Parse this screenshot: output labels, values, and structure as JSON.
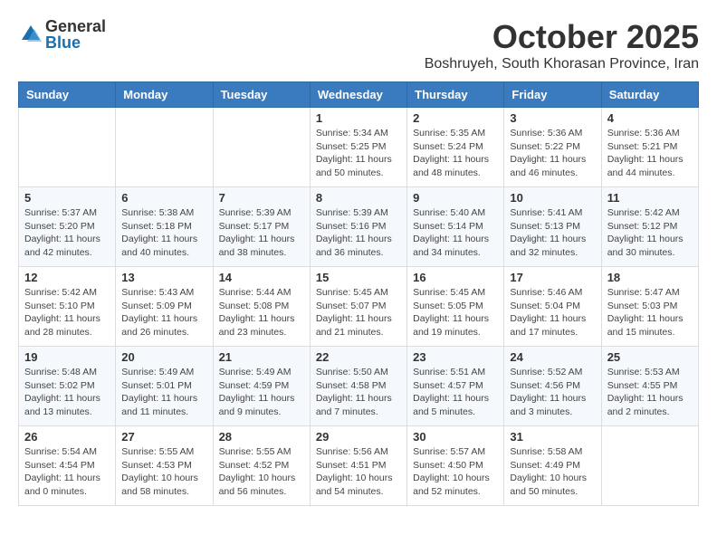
{
  "header": {
    "logo_general": "General",
    "logo_blue": "Blue",
    "month": "October 2025",
    "location": "Boshruyeh, South Khorasan Province, Iran"
  },
  "weekdays": [
    "Sunday",
    "Monday",
    "Tuesday",
    "Wednesday",
    "Thursday",
    "Friday",
    "Saturday"
  ],
  "weeks": [
    [
      {
        "day": "",
        "info": ""
      },
      {
        "day": "",
        "info": ""
      },
      {
        "day": "",
        "info": ""
      },
      {
        "day": "1",
        "info": "Sunrise: 5:34 AM\nSunset: 5:25 PM\nDaylight: 11 hours\nand 50 minutes."
      },
      {
        "day": "2",
        "info": "Sunrise: 5:35 AM\nSunset: 5:24 PM\nDaylight: 11 hours\nand 48 minutes."
      },
      {
        "day": "3",
        "info": "Sunrise: 5:36 AM\nSunset: 5:22 PM\nDaylight: 11 hours\nand 46 minutes."
      },
      {
        "day": "4",
        "info": "Sunrise: 5:36 AM\nSunset: 5:21 PM\nDaylight: 11 hours\nand 44 minutes."
      }
    ],
    [
      {
        "day": "5",
        "info": "Sunrise: 5:37 AM\nSunset: 5:20 PM\nDaylight: 11 hours\nand 42 minutes."
      },
      {
        "day": "6",
        "info": "Sunrise: 5:38 AM\nSunset: 5:18 PM\nDaylight: 11 hours\nand 40 minutes."
      },
      {
        "day": "7",
        "info": "Sunrise: 5:39 AM\nSunset: 5:17 PM\nDaylight: 11 hours\nand 38 minutes."
      },
      {
        "day": "8",
        "info": "Sunrise: 5:39 AM\nSunset: 5:16 PM\nDaylight: 11 hours\nand 36 minutes."
      },
      {
        "day": "9",
        "info": "Sunrise: 5:40 AM\nSunset: 5:14 PM\nDaylight: 11 hours\nand 34 minutes."
      },
      {
        "day": "10",
        "info": "Sunrise: 5:41 AM\nSunset: 5:13 PM\nDaylight: 11 hours\nand 32 minutes."
      },
      {
        "day": "11",
        "info": "Sunrise: 5:42 AM\nSunset: 5:12 PM\nDaylight: 11 hours\nand 30 minutes."
      }
    ],
    [
      {
        "day": "12",
        "info": "Sunrise: 5:42 AM\nSunset: 5:10 PM\nDaylight: 11 hours\nand 28 minutes."
      },
      {
        "day": "13",
        "info": "Sunrise: 5:43 AM\nSunset: 5:09 PM\nDaylight: 11 hours\nand 26 minutes."
      },
      {
        "day": "14",
        "info": "Sunrise: 5:44 AM\nSunset: 5:08 PM\nDaylight: 11 hours\nand 23 minutes."
      },
      {
        "day": "15",
        "info": "Sunrise: 5:45 AM\nSunset: 5:07 PM\nDaylight: 11 hours\nand 21 minutes."
      },
      {
        "day": "16",
        "info": "Sunrise: 5:45 AM\nSunset: 5:05 PM\nDaylight: 11 hours\nand 19 minutes."
      },
      {
        "day": "17",
        "info": "Sunrise: 5:46 AM\nSunset: 5:04 PM\nDaylight: 11 hours\nand 17 minutes."
      },
      {
        "day": "18",
        "info": "Sunrise: 5:47 AM\nSunset: 5:03 PM\nDaylight: 11 hours\nand 15 minutes."
      }
    ],
    [
      {
        "day": "19",
        "info": "Sunrise: 5:48 AM\nSunset: 5:02 PM\nDaylight: 11 hours\nand 13 minutes."
      },
      {
        "day": "20",
        "info": "Sunrise: 5:49 AM\nSunset: 5:01 PM\nDaylight: 11 hours\nand 11 minutes."
      },
      {
        "day": "21",
        "info": "Sunrise: 5:49 AM\nSunset: 4:59 PM\nDaylight: 11 hours\nand 9 minutes."
      },
      {
        "day": "22",
        "info": "Sunrise: 5:50 AM\nSunset: 4:58 PM\nDaylight: 11 hours\nand 7 minutes."
      },
      {
        "day": "23",
        "info": "Sunrise: 5:51 AM\nSunset: 4:57 PM\nDaylight: 11 hours\nand 5 minutes."
      },
      {
        "day": "24",
        "info": "Sunrise: 5:52 AM\nSunset: 4:56 PM\nDaylight: 11 hours\nand 3 minutes."
      },
      {
        "day": "25",
        "info": "Sunrise: 5:53 AM\nSunset: 4:55 PM\nDaylight: 11 hours\nand 2 minutes."
      }
    ],
    [
      {
        "day": "26",
        "info": "Sunrise: 5:54 AM\nSunset: 4:54 PM\nDaylight: 11 hours\nand 0 minutes."
      },
      {
        "day": "27",
        "info": "Sunrise: 5:55 AM\nSunset: 4:53 PM\nDaylight: 10 hours\nand 58 minutes."
      },
      {
        "day": "28",
        "info": "Sunrise: 5:55 AM\nSunset: 4:52 PM\nDaylight: 10 hours\nand 56 minutes."
      },
      {
        "day": "29",
        "info": "Sunrise: 5:56 AM\nSunset: 4:51 PM\nDaylight: 10 hours\nand 54 minutes."
      },
      {
        "day": "30",
        "info": "Sunrise: 5:57 AM\nSunset: 4:50 PM\nDaylight: 10 hours\nand 52 minutes."
      },
      {
        "day": "31",
        "info": "Sunrise: 5:58 AM\nSunset: 4:49 PM\nDaylight: 10 hours\nand 50 minutes."
      },
      {
        "day": "",
        "info": ""
      }
    ]
  ]
}
